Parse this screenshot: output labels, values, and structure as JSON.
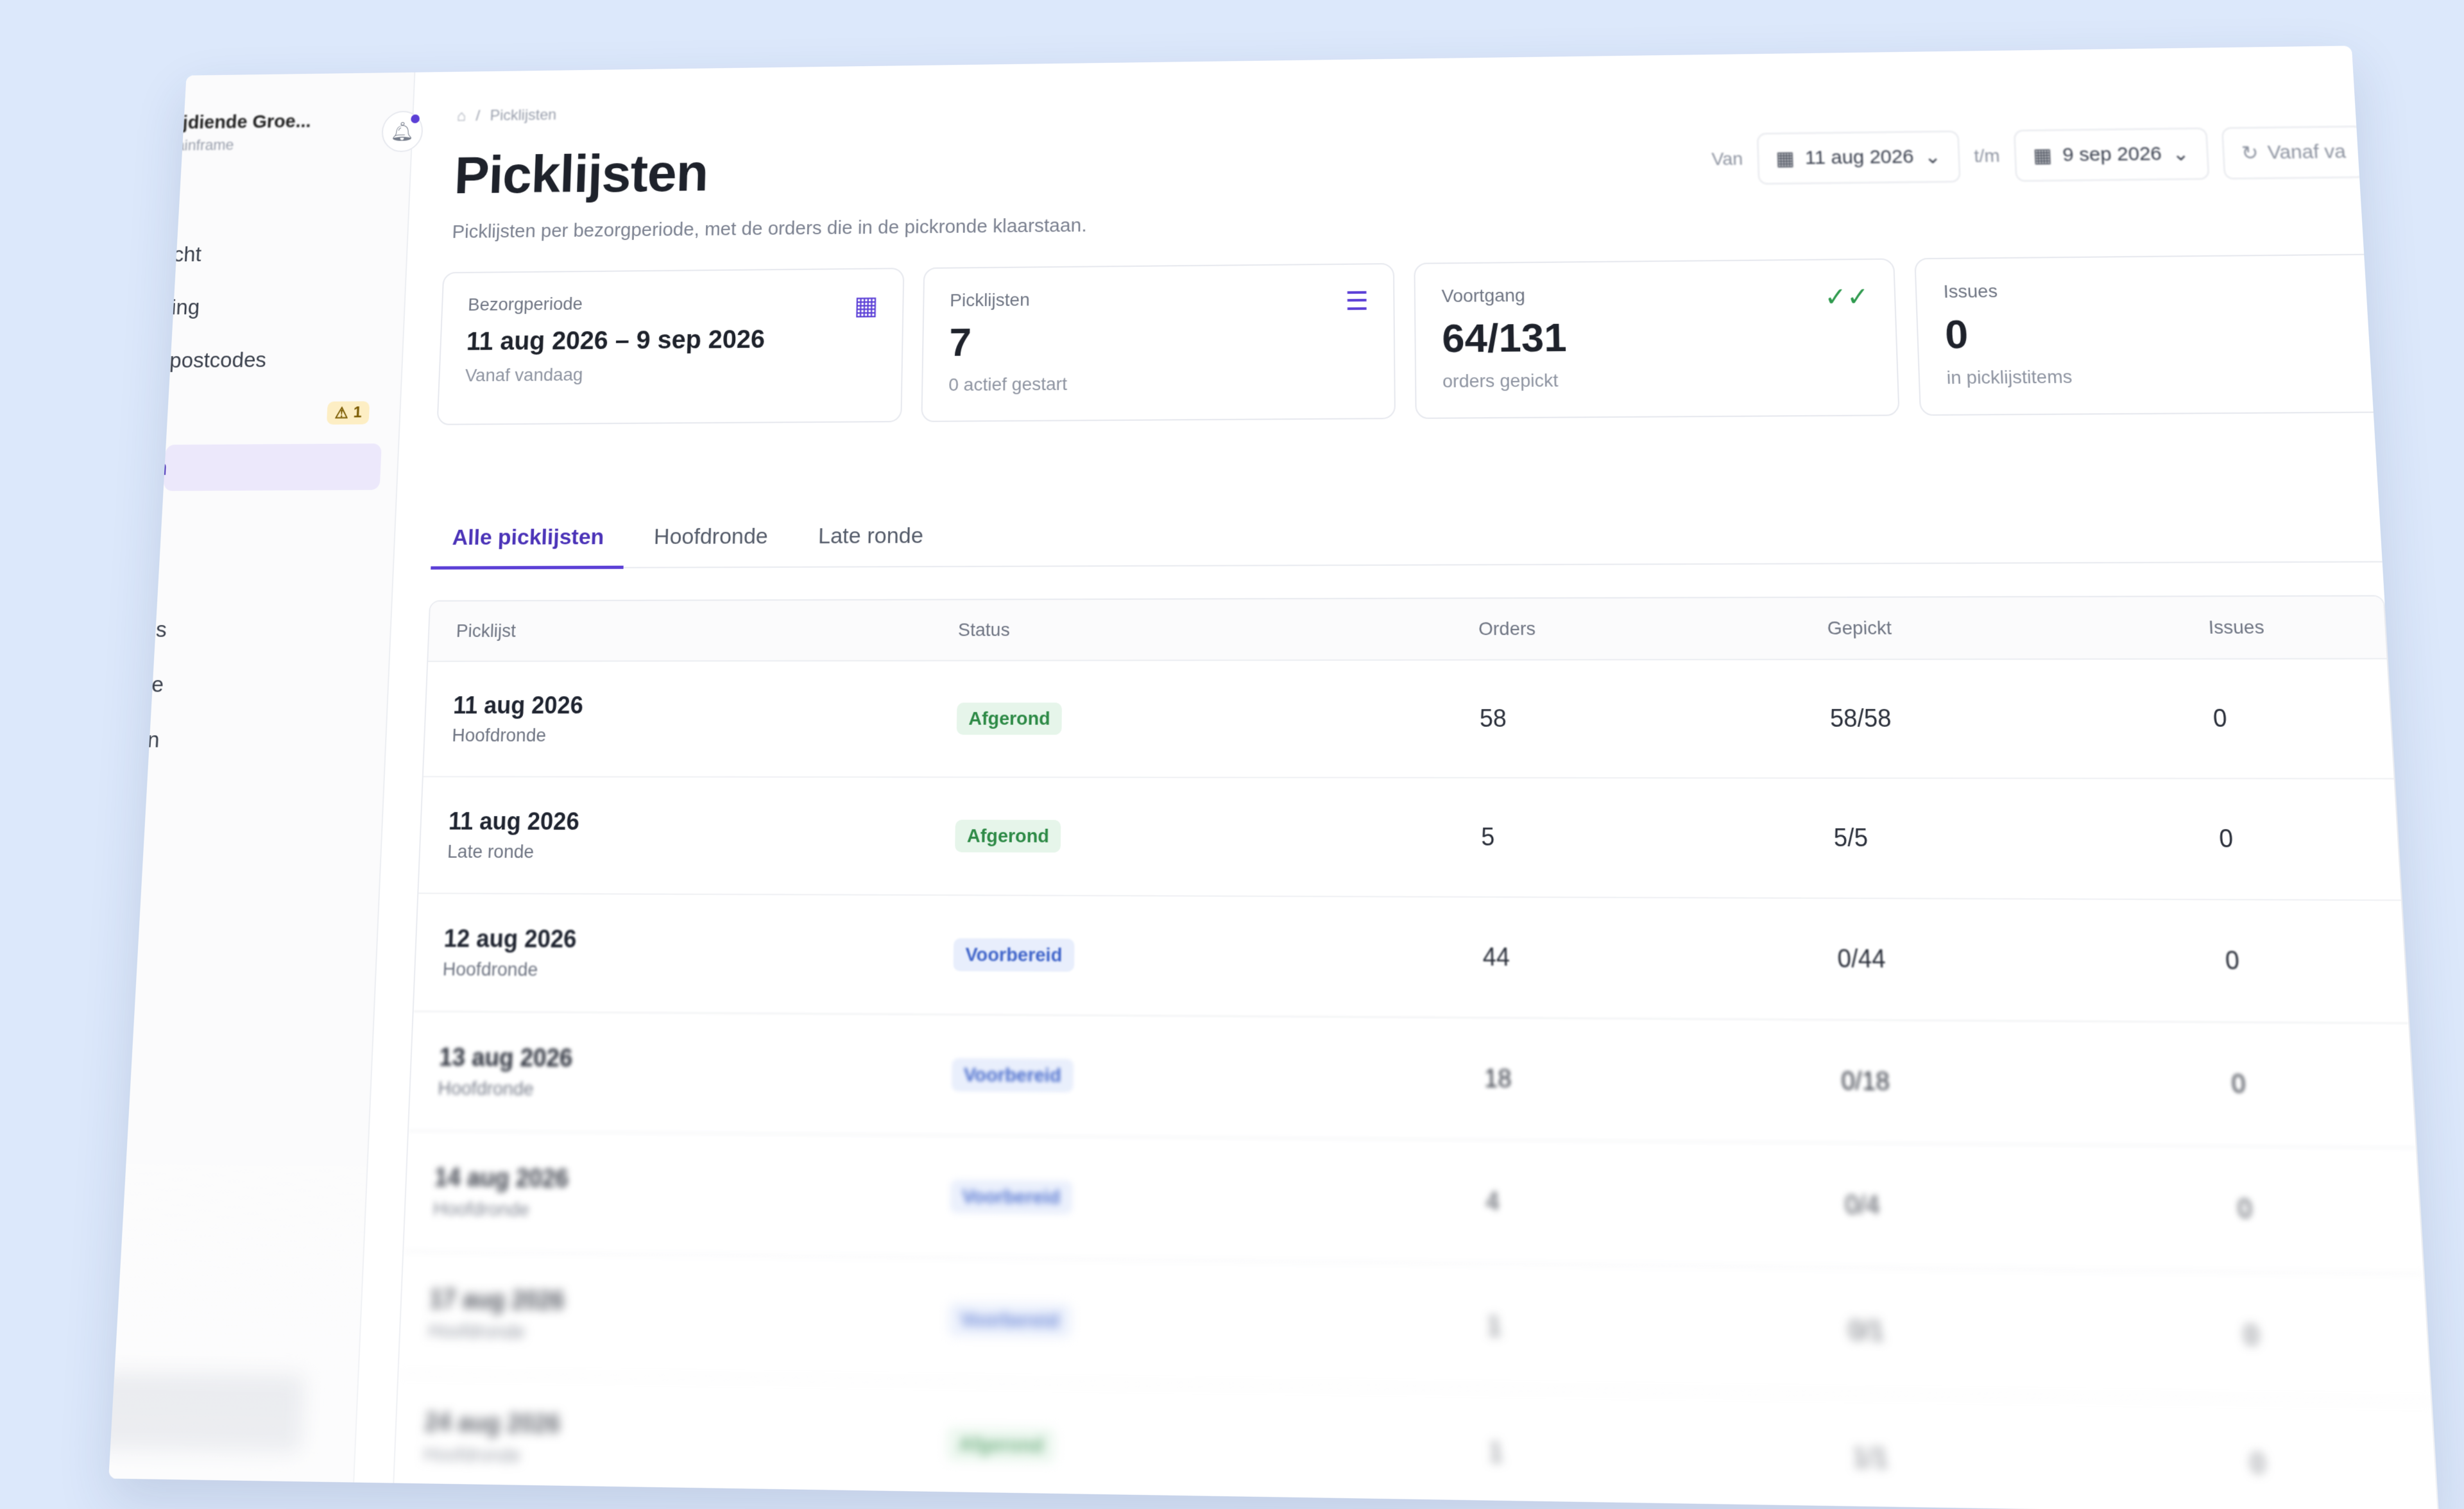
{
  "sidebar": {
    "org_name": "ijdiende Groe...",
    "org_sub": "ainframe",
    "items": [
      {
        "label": "erzicht"
      },
      {
        "label": "anning"
      },
      {
        "label": "s & postcodes"
      },
      {
        "label": "",
        "badge": "1"
      },
      {
        "label": "sten"
      },
      {
        "label": "s"
      },
      {
        "label": "rders"
      },
      {
        "label": "rtage"
      },
      {
        "label": "ngen"
      }
    ]
  },
  "breadcrumb": {
    "current": "Picklijsten"
  },
  "page": {
    "title": "Picklijsten",
    "subtitle": "Picklijsten per bezorgperiode, met de orders die in de pickronde klaarstaan."
  },
  "filters": {
    "from_label": "Van",
    "from_date": "11 aug 2026",
    "to_label": "t/m",
    "to_date": "9 sep 2026",
    "reset_label": "Vanaf va"
  },
  "cards": {
    "period": {
      "label": "Bezorgperiode",
      "value": "11 aug 2026 – 9 sep 2026",
      "note": "Vanaf vandaag"
    },
    "lists": {
      "label": "Picklijsten",
      "value": "7",
      "note": "0 actief gestart"
    },
    "progress": {
      "label": "Voortgang",
      "value": "64/131",
      "note": "orders gepickt"
    },
    "issues": {
      "label": "Issues",
      "value": "0",
      "note": "in picklijstitems"
    }
  },
  "tabs": [
    "Alle picklijsten",
    "Hoofdronde",
    "Late ronde"
  ],
  "table": {
    "headers": [
      "Picklijst",
      "Status",
      "Orders",
      "Gepickt",
      "Issues"
    ],
    "rows": [
      {
        "date": "11 aug 2026",
        "round": "Hoofdronde",
        "status": "Afgerond",
        "orders": "58",
        "picked": "58/58",
        "issues": "0"
      },
      {
        "date": "11 aug 2026",
        "round": "Late ronde",
        "status": "Afgerond",
        "orders": "5",
        "picked": "5/5",
        "issues": "0"
      },
      {
        "date": "12 aug 2026",
        "round": "Hoofdronde",
        "status": "Voorbereid",
        "orders": "44",
        "picked": "0/44",
        "issues": "0"
      },
      {
        "date": "13 aug 2026",
        "round": "Hoofdronde",
        "status": "Voorbereid",
        "orders": "18",
        "picked": "0/18",
        "issues": "0"
      },
      {
        "date": "14 aug 2026",
        "round": "Hoofdronde",
        "status": "Voorbereid",
        "orders": "4",
        "picked": "0/4",
        "issues": "0"
      },
      {
        "date": "17 aug 2026",
        "round": "Hoofdronde",
        "status": "Voorbereid",
        "orders": "1",
        "picked": "0/1",
        "issues": "0"
      },
      {
        "date": "24 aug 2026",
        "round": "Hoofdronde",
        "status": "Afgerond",
        "orders": "1",
        "picked": "1/1",
        "issues": "0"
      }
    ]
  },
  "colors": {
    "accent": "#5b3fd6",
    "done_bg": "#e6f5ea",
    "done_fg": "#2d8a46",
    "prep_bg": "#e8eefc",
    "prep_fg": "#3e63c9"
  }
}
